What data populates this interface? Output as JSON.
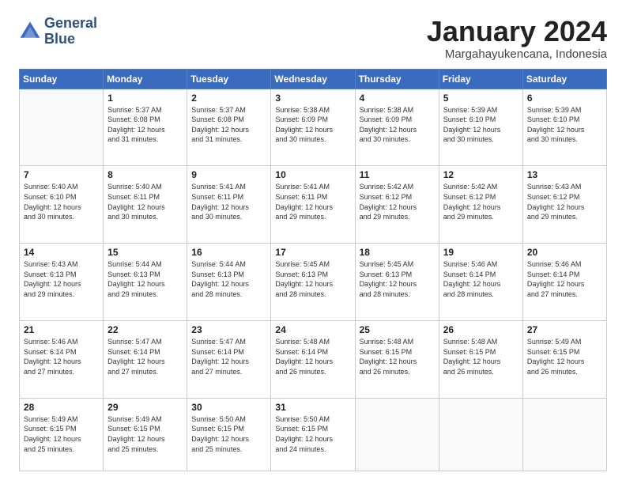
{
  "logo": {
    "line1": "General",
    "line2": "Blue"
  },
  "header": {
    "title": "January 2024",
    "subtitle": "Margahayukencana, Indonesia"
  },
  "columns": [
    "Sunday",
    "Monday",
    "Tuesday",
    "Wednesday",
    "Thursday",
    "Friday",
    "Saturday"
  ],
  "weeks": [
    [
      {
        "day": "",
        "info": ""
      },
      {
        "day": "1",
        "info": "Sunrise: 5:37 AM\nSunset: 6:08 PM\nDaylight: 12 hours\nand 31 minutes."
      },
      {
        "day": "2",
        "info": "Sunrise: 5:37 AM\nSunset: 6:08 PM\nDaylight: 12 hours\nand 31 minutes."
      },
      {
        "day": "3",
        "info": "Sunrise: 5:38 AM\nSunset: 6:09 PM\nDaylight: 12 hours\nand 30 minutes."
      },
      {
        "day": "4",
        "info": "Sunrise: 5:38 AM\nSunset: 6:09 PM\nDaylight: 12 hours\nand 30 minutes."
      },
      {
        "day": "5",
        "info": "Sunrise: 5:39 AM\nSunset: 6:10 PM\nDaylight: 12 hours\nand 30 minutes."
      },
      {
        "day": "6",
        "info": "Sunrise: 5:39 AM\nSunset: 6:10 PM\nDaylight: 12 hours\nand 30 minutes."
      }
    ],
    [
      {
        "day": "7",
        "info": "Sunrise: 5:40 AM\nSunset: 6:10 PM\nDaylight: 12 hours\nand 30 minutes."
      },
      {
        "day": "8",
        "info": "Sunrise: 5:40 AM\nSunset: 6:11 PM\nDaylight: 12 hours\nand 30 minutes."
      },
      {
        "day": "9",
        "info": "Sunrise: 5:41 AM\nSunset: 6:11 PM\nDaylight: 12 hours\nand 30 minutes."
      },
      {
        "day": "10",
        "info": "Sunrise: 5:41 AM\nSunset: 6:11 PM\nDaylight: 12 hours\nand 29 minutes."
      },
      {
        "day": "11",
        "info": "Sunrise: 5:42 AM\nSunset: 6:12 PM\nDaylight: 12 hours\nand 29 minutes."
      },
      {
        "day": "12",
        "info": "Sunrise: 5:42 AM\nSunset: 6:12 PM\nDaylight: 12 hours\nand 29 minutes."
      },
      {
        "day": "13",
        "info": "Sunrise: 5:43 AM\nSunset: 6:12 PM\nDaylight: 12 hours\nand 29 minutes."
      }
    ],
    [
      {
        "day": "14",
        "info": "Sunrise: 5:43 AM\nSunset: 6:13 PM\nDaylight: 12 hours\nand 29 minutes."
      },
      {
        "day": "15",
        "info": "Sunrise: 5:44 AM\nSunset: 6:13 PM\nDaylight: 12 hours\nand 29 minutes."
      },
      {
        "day": "16",
        "info": "Sunrise: 5:44 AM\nSunset: 6:13 PM\nDaylight: 12 hours\nand 28 minutes."
      },
      {
        "day": "17",
        "info": "Sunrise: 5:45 AM\nSunset: 6:13 PM\nDaylight: 12 hours\nand 28 minutes."
      },
      {
        "day": "18",
        "info": "Sunrise: 5:45 AM\nSunset: 6:13 PM\nDaylight: 12 hours\nand 28 minutes."
      },
      {
        "day": "19",
        "info": "Sunrise: 5:46 AM\nSunset: 6:14 PM\nDaylight: 12 hours\nand 28 minutes."
      },
      {
        "day": "20",
        "info": "Sunrise: 5:46 AM\nSunset: 6:14 PM\nDaylight: 12 hours\nand 27 minutes."
      }
    ],
    [
      {
        "day": "21",
        "info": "Sunrise: 5:46 AM\nSunset: 6:14 PM\nDaylight: 12 hours\nand 27 minutes."
      },
      {
        "day": "22",
        "info": "Sunrise: 5:47 AM\nSunset: 6:14 PM\nDaylight: 12 hours\nand 27 minutes."
      },
      {
        "day": "23",
        "info": "Sunrise: 5:47 AM\nSunset: 6:14 PM\nDaylight: 12 hours\nand 27 minutes."
      },
      {
        "day": "24",
        "info": "Sunrise: 5:48 AM\nSunset: 6:14 PM\nDaylight: 12 hours\nand 26 minutes."
      },
      {
        "day": "25",
        "info": "Sunrise: 5:48 AM\nSunset: 6:15 PM\nDaylight: 12 hours\nand 26 minutes."
      },
      {
        "day": "26",
        "info": "Sunrise: 5:48 AM\nSunset: 6:15 PM\nDaylight: 12 hours\nand 26 minutes."
      },
      {
        "day": "27",
        "info": "Sunrise: 5:49 AM\nSunset: 6:15 PM\nDaylight: 12 hours\nand 26 minutes."
      }
    ],
    [
      {
        "day": "28",
        "info": "Sunrise: 5:49 AM\nSunset: 6:15 PM\nDaylight: 12 hours\nand 25 minutes."
      },
      {
        "day": "29",
        "info": "Sunrise: 5:49 AM\nSunset: 6:15 PM\nDaylight: 12 hours\nand 25 minutes."
      },
      {
        "day": "30",
        "info": "Sunrise: 5:50 AM\nSunset: 6:15 PM\nDaylight: 12 hours\nand 25 minutes."
      },
      {
        "day": "31",
        "info": "Sunrise: 5:50 AM\nSunset: 6:15 PM\nDaylight: 12 hours\nand 24 minutes."
      },
      {
        "day": "",
        "info": ""
      },
      {
        "day": "",
        "info": ""
      },
      {
        "day": "",
        "info": ""
      }
    ]
  ]
}
